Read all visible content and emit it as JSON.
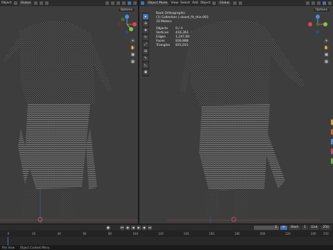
{
  "left_header": {
    "mode_label": "Object",
    "orientation_label": "Global"
  },
  "right_header": {
    "mode_label": "Object Mode",
    "menu": [
      "View",
      "Select",
      "Add",
      "Object"
    ],
    "orientation_label": "Global"
  },
  "viewport_left": {
    "options_label": "Options"
  },
  "viewport_right": {
    "options_label": "Options",
    "overlay": {
      "view_name": "Back Orthographic",
      "collection": "(1) Collection | closet_fit_thin.001",
      "scale": "10 Meters",
      "stats": [
        {
          "label": "Objects",
          "value": "0 / 4"
        },
        {
          "label": "Vertices",
          "value": "416,363"
        },
        {
          "label": "Edges",
          "value": "1,247,691"
        },
        {
          "label": "Faces",
          "value": "836,888"
        },
        {
          "label": "Triangles",
          "value": "831,031"
        }
      ]
    }
  },
  "gizmo": {
    "x": "X",
    "y": "Y",
    "z": "Z"
  },
  "timeline": {
    "current_frame": "1",
    "start_label": "Start",
    "start_value": "1",
    "end_label": "End",
    "end_value": "250",
    "ticks": [
      "0",
      "20",
      "40",
      "60",
      "80",
      "100",
      "120",
      "140",
      "160",
      "180",
      "200",
      "220",
      "240",
      "250"
    ]
  },
  "statusbar": {
    "left": "Pan View",
    "middle": "Object Context Menu"
  },
  "colors": {
    "accent": "#4772b3",
    "axis_x": "#e0435a",
    "axis_y": "#7ec93c",
    "axis_z": "#4f8cde"
  }
}
